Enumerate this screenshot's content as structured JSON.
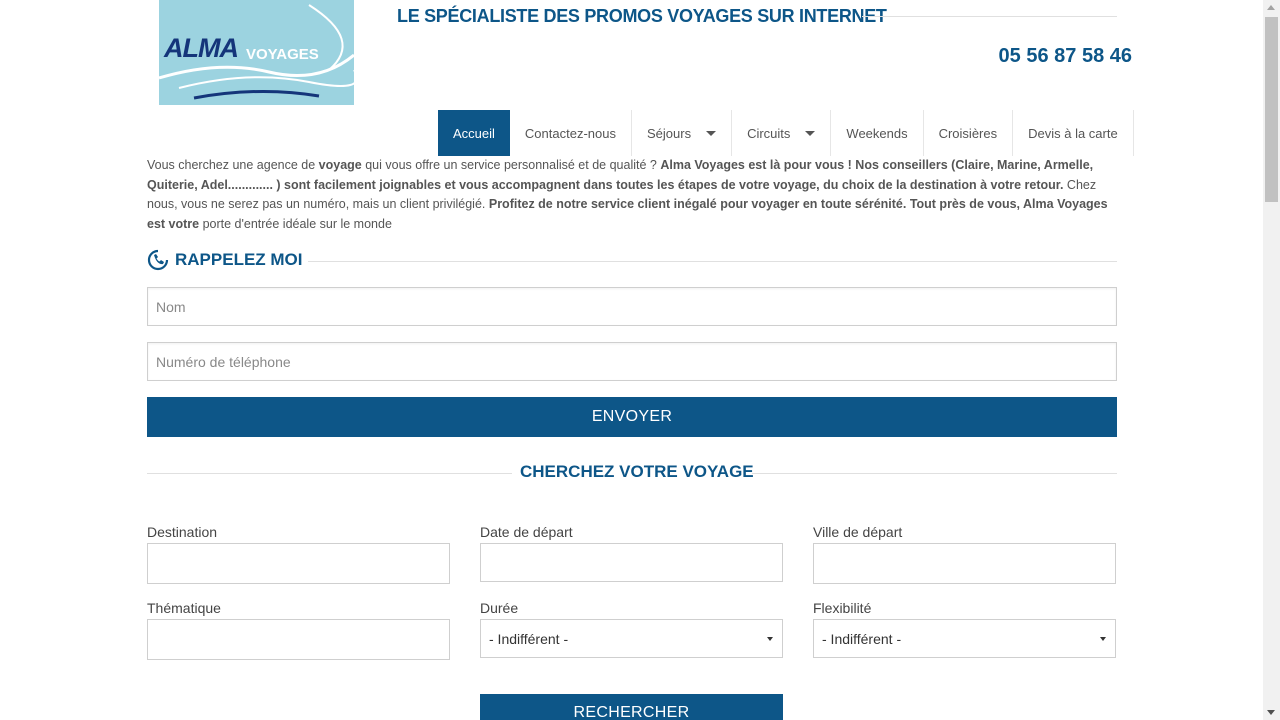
{
  "header": {
    "logo": {
      "word": "ALMA",
      "sub": "VOYAGES",
      "bg_color": "#9cd3e0"
    },
    "tagline": "LE SPÉCIALISTE DES PROMOS VOYAGES SUR INTERNET",
    "phone": "05 56 87 58 46"
  },
  "nav": {
    "items": [
      {
        "label": "Accueil",
        "active": true
      },
      {
        "label": "Contactez-nous"
      },
      {
        "label": "Séjours",
        "dropdown": true
      },
      {
        "label": "Circuits",
        "dropdown": true
      },
      {
        "label": "Weekends"
      },
      {
        "label": "Croisières"
      },
      {
        "label": "Devis à la carte"
      }
    ]
  },
  "intro": {
    "p1": "Vous cherchez une agence de ",
    "b1": "voyage",
    "p2": " qui vous offre un service personnalisé et de qualité ? ",
    "b2": "Alma Voyages est là pour vous ! Nos conseillers (Claire, Marine, Armelle, Quiterie, Adel............. ) sont facilement joignables et vous accompagnent dans toutes les étapes de votre voyage, du choix de la destination à votre retour.",
    "p3": " Chez nous, vous ne serez pas un numéro, mais un client privilégié. ",
    "b3": "Profitez de notre service client inégalé pour voyager en toute sérénité. Tout près de vous, Alma Voyages est votre",
    "p4": " porte d'entrée idéale sur le monde"
  },
  "callback": {
    "title": "RAPPELEZ MOI",
    "icon": "phone-callback-icon",
    "name_placeholder": "Nom",
    "phone_placeholder": "Numéro de téléphone",
    "submit": "ENVOYER"
  },
  "search": {
    "title": "CHERCHEZ VOTRE VOYAGE",
    "destination_label": "Destination",
    "date_label": "Date de départ",
    "city_label": "Ville de départ",
    "theme_label": "Thématique",
    "duration_label": "Durée",
    "duration_value": "- Indifférent -",
    "flex_label": "Flexibilité",
    "flex_value": "- Indifférent -",
    "submit": "RECHERCHER"
  },
  "colors": {
    "brand": "#0d5688",
    "text": "#444444"
  }
}
